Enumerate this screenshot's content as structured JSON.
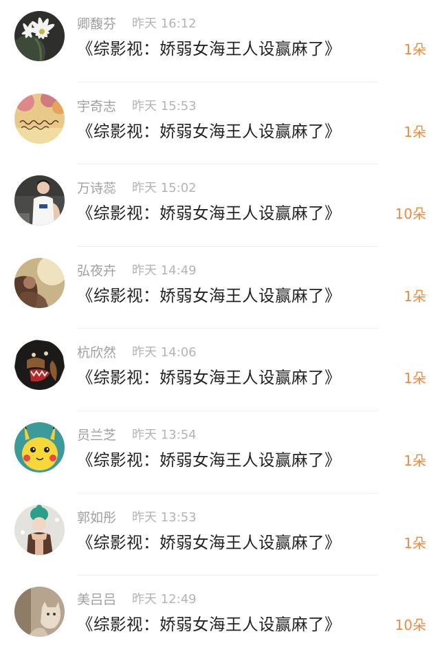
{
  "rows": [
    {
      "name": "卿馥芬",
      "time": "昨天 16:12",
      "title": "《综影视：娇弱女海王人设赢麻了》",
      "count": "1朵",
      "avatar": "daisy-flower-avatar"
    },
    {
      "name": "宇奇志",
      "time": "昨天 15:53",
      "title": "《综影视：娇弱女海王人设赢麻了》",
      "count": "1朵",
      "avatar": "handwriting-flowers-avatar"
    },
    {
      "name": "万诗蕊",
      "time": "昨天 15:02",
      "title": "《综影视：娇弱女海王人设赢麻了》",
      "count": "10朵",
      "avatar": "basketball-boy-avatar"
    },
    {
      "name": "弘夜卉",
      "time": "昨天 14:49",
      "title": "《综影视：娇弱女海王人设赢麻了》",
      "count": "1朵",
      "avatar": "sepia-girl-avatar"
    },
    {
      "name": "杭欣然",
      "time": "昨天 14:06",
      "title": "《综影视：娇弱女海王人设赢麻了》",
      "count": "1朵",
      "avatar": "barking-dog-avatar"
    },
    {
      "name": "员兰芝",
      "time": "昨天 13:54",
      "title": "《综影视：娇弱女海王人设赢麻了》",
      "count": "1朵",
      "avatar": "pikachu-avatar"
    },
    {
      "name": "郭如彤",
      "time": "昨天 13:53",
      "title": "《综影视：娇弱女海王人设赢麻了》",
      "count": "1朵",
      "avatar": "winter-girl-avatar"
    },
    {
      "name": "美吕吕",
      "time": "昨天 12:49",
      "title": "《综影视：娇弱女海王人设赢麻了》",
      "count": "10朵",
      "avatar": "beige-toy-avatar"
    }
  ],
  "colors": {
    "name": "#a0a0a0",
    "time": "#b4b4b4",
    "title": "#222222",
    "count_accent": "#f18a3b",
    "divider": "#efefef"
  }
}
